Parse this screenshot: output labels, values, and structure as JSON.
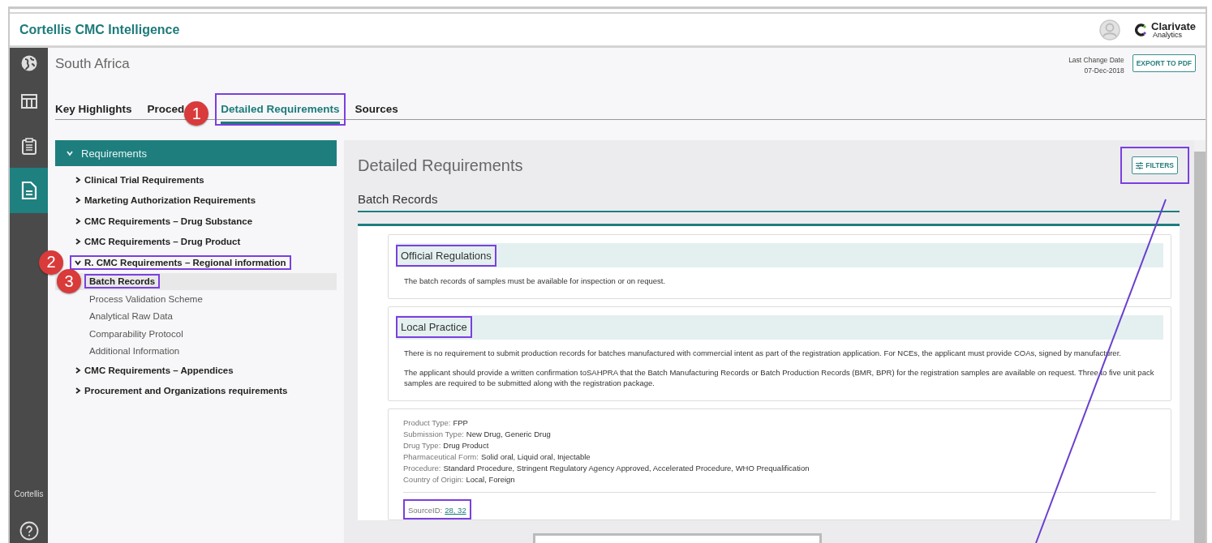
{
  "app": {
    "title": "Cortellis CMC Intelligence",
    "logo_name": "Clarivate",
    "logo_sub": "Analytics"
  },
  "rail": {
    "items": [
      {
        "selected": false
      },
      {
        "selected": false
      },
      {
        "selected": false
      },
      {
        "selected": true
      }
    ],
    "footer_label": "Cortellis"
  },
  "page": {
    "country": "South Africa",
    "last_change_label": "Last Change Date",
    "last_change_date": "07-Dec-2018",
    "export_button": "EXPORT TO PDF"
  },
  "tabs": [
    {
      "label": "Key Highlights",
      "selected": false,
      "highlighted": false
    },
    {
      "label": "Proced",
      "selected": false,
      "highlighted": false
    },
    {
      "label": "Detailed Requirements",
      "selected": true,
      "highlighted": true,
      "annotation": "1"
    },
    {
      "label": "Sources",
      "selected": false,
      "highlighted": false
    }
  ],
  "tree": {
    "header": "Requirements",
    "expanded": true,
    "items": [
      {
        "label": "Clinical Trial Requirements",
        "expanded": false,
        "highlighted": false
      },
      {
        "label": "Marketing Authorization Requirements",
        "expanded": false,
        "highlighted": false
      },
      {
        "label": "CMC Requirements – Drug Substance",
        "expanded": false,
        "highlighted": false
      },
      {
        "label": "CMC Requirements – Drug Product",
        "expanded": false,
        "highlighted": false
      },
      {
        "label": "R. CMC Requirements – Regional information",
        "expanded": true,
        "highlighted": true,
        "annotation": "2",
        "children": [
          {
            "label": "Batch Records",
            "selected": true,
            "highlighted": true,
            "annotation": "3"
          },
          {
            "label": "Process Validation Scheme",
            "selected": false,
            "highlighted": false
          },
          {
            "label": "Analytical Raw Data",
            "selected": false,
            "highlighted": false
          },
          {
            "label": "Comparability Protocol",
            "selected": false,
            "highlighted": false
          },
          {
            "label": "Additional Information",
            "selected": false,
            "highlighted": false
          }
        ]
      },
      {
        "label": "CMC Requirements – Appendices",
        "expanded": false,
        "highlighted": false
      },
      {
        "label": "Procurement and Organizations requirements",
        "expanded": false,
        "highlighted": false
      }
    ]
  },
  "detail": {
    "title": "Detailed Requirements",
    "filters_button": "FILTERS",
    "filters_highlighted": true,
    "section": "Batch Records",
    "cards": [
      {
        "kind": "section",
        "heading": "Official Regulations",
        "highlighted": true,
        "paragraphs": [
          "The batch records of samples must be available for inspection or on request."
        ]
      },
      {
        "kind": "section",
        "heading": "Local Practice",
        "highlighted": true,
        "paragraphs": [
          "There is no requirement to submit production records for batches manufactured with commercial intent as part of the registration application. For NCEs, the applicant must provide COAs, signed by manufacturer.",
          "The applicant should provide a written confirmation toSAHPRA that the Batch Manufacturing Records or Batch Production Records (BMR, BPR) for the registration samples are available on request. Three to five unit pack samples are required to be submitted along with the registration package."
        ]
      },
      {
        "kind": "meta",
        "fields": [
          {
            "label": "Product Type:",
            "value": "FPP"
          },
          {
            "label": "Submission Type:",
            "value": "New Drug, Generic Drug"
          },
          {
            "label": "Drug Type:",
            "value": "Drug Product"
          },
          {
            "label": "Pharmaceutical Form:",
            "value": "Solid oral, Liquid oral, Injectable"
          },
          {
            "label": "Procedure:",
            "value": "Standard Procedure, Stringent Regulatory Agency Approved, Accelerated Procedure, WHO Prequalification"
          },
          {
            "label": "Country of Origin:",
            "value": "Local, Foreign"
          }
        ],
        "source_label": "SourceID:",
        "source_links": "28, 32",
        "highlighted": true
      }
    ]
  }
}
